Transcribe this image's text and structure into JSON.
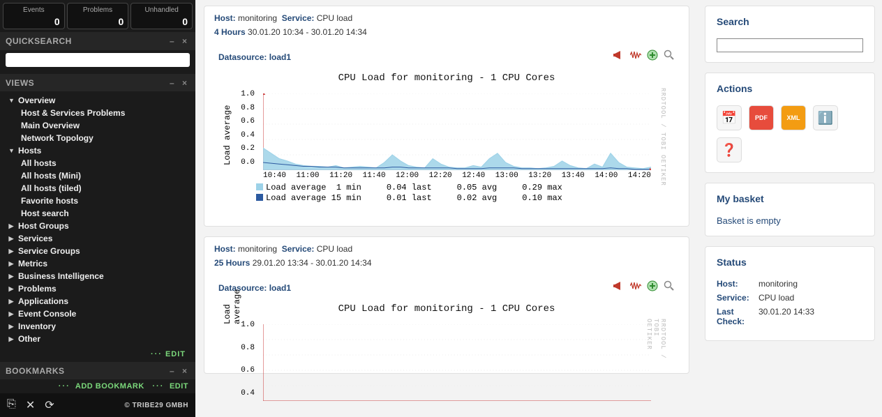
{
  "topstats": [
    {
      "label": "Events",
      "value": "0"
    },
    {
      "label": "Problems",
      "value": "0"
    },
    {
      "label": "Unhandled",
      "value": "0"
    }
  ],
  "quicksearch": {
    "title": "QUICKSEARCH",
    "value": ""
  },
  "views": {
    "title": "VIEWS",
    "edit": "EDIT",
    "tree": [
      {
        "label": "Overview",
        "bold": true,
        "expanded": true,
        "children": [
          {
            "label": "Host & Services Problems"
          },
          {
            "label": "Main Overview"
          },
          {
            "label": "Network Topology"
          }
        ]
      },
      {
        "label": "Hosts",
        "bold": true,
        "expanded": true,
        "children": [
          {
            "label": "All hosts"
          },
          {
            "label": "All hosts (Mini)"
          },
          {
            "label": "All hosts (tiled)"
          },
          {
            "label": "Favorite hosts"
          },
          {
            "label": "Host search"
          }
        ]
      },
      {
        "label": "Host Groups",
        "bold": true
      },
      {
        "label": "Services",
        "bold": true
      },
      {
        "label": "Service Groups",
        "bold": true
      },
      {
        "label": "Metrics",
        "bold": true
      },
      {
        "label": "Business Intelligence",
        "bold": true
      },
      {
        "label": "Problems",
        "bold": true
      },
      {
        "label": "Applications",
        "bold": true
      },
      {
        "label": "Event Console",
        "bold": true
      },
      {
        "label": "Inventory",
        "bold": true
      },
      {
        "label": "Other",
        "bold": true
      }
    ]
  },
  "bookmarks": {
    "title": "BOOKMARKS",
    "add": "ADD BOOKMARK",
    "edit": "EDIT"
  },
  "footer": {
    "copyright": "© TRIBE29 GMBH"
  },
  "panels": [
    {
      "host_label": "Host:",
      "host": "monitoring",
      "service_label": "Service:",
      "service": "CPU load",
      "range_label": "4 Hours",
      "range": "30.01.20 10:34 - 30.01.20 14:34",
      "datasource_label": "Datasource:",
      "datasource": "load1",
      "chart_title": "CPU Load for monitoring - 1 CPU Cores",
      "axis_label": "Load average",
      "watermark": "RRDTOOL / TOBI OETIKER",
      "legend_lines": [
        "Load average  1 min     0.04 last     0.05 avg     0.29 max",
        "Load average 15 min     0.01 last     0.02 avg     0.10 max"
      ],
      "legend_colors": [
        "#9dd2e8",
        "#2c5aa0"
      ]
    },
    {
      "host_label": "Host:",
      "host": "monitoring",
      "service_label": "Service:",
      "service": "CPU load",
      "range_label": "25 Hours",
      "range": "29.01.20 13:34 - 30.01.20 14:34",
      "datasource_label": "Datasource:",
      "datasource": "load1",
      "chart_title": "CPU Load for monitoring - 1 CPU Cores",
      "axis_label": "Load average",
      "watermark": "RRDTOOL / TOBI OETIKER"
    }
  ],
  "chart_data": [
    {
      "type": "area",
      "title": "CPU Load for monitoring - 1 CPU Cores",
      "xlabel": "",
      "ylabel": "Load average",
      "ylim": [
        0,
        1.0
      ],
      "x_ticks": [
        "10:40",
        "11:00",
        "11:20",
        "11:40",
        "12:00",
        "12:20",
        "12:40",
        "13:00",
        "13:20",
        "13:40",
        "14:00",
        "14:20"
      ],
      "y_ticks": [
        0.0,
        0.2,
        0.4,
        0.6,
        0.8,
        1.0
      ],
      "series": [
        {
          "name": "Load average 1 min",
          "color": "#9dd2e8",
          "stats": {
            "last": 0.04,
            "avg": 0.05,
            "max": 0.29
          },
          "values": [
            0.29,
            0.22,
            0.15,
            0.12,
            0.08,
            0.06,
            0.05,
            0.05,
            0.04,
            0.06,
            0.03,
            0.04,
            0.05,
            0.04,
            0.03,
            0.1,
            0.2,
            0.12,
            0.06,
            0.04,
            0.03,
            0.15,
            0.08,
            0.04,
            0.03,
            0.03,
            0.06,
            0.04,
            0.15,
            0.22,
            0.1,
            0.05,
            0.03,
            0.03,
            0.02,
            0.03,
            0.05,
            0.12,
            0.06,
            0.03,
            0.02,
            0.08,
            0.04,
            0.22,
            0.1,
            0.04,
            0.03,
            0.02,
            0.04
          ]
        },
        {
          "name": "Load average 15 min",
          "color": "#2c5aa0",
          "stats": {
            "last": 0.01,
            "avg": 0.02,
            "max": 0.1
          },
          "values": [
            0.1,
            0.09,
            0.08,
            0.07,
            0.06,
            0.05,
            0.05,
            0.04,
            0.04,
            0.04,
            0.03,
            0.03,
            0.03,
            0.03,
            0.03,
            0.03,
            0.04,
            0.04,
            0.03,
            0.03,
            0.03,
            0.03,
            0.03,
            0.03,
            0.02,
            0.02,
            0.02,
            0.02,
            0.03,
            0.03,
            0.03,
            0.03,
            0.02,
            0.02,
            0.02,
            0.02,
            0.02,
            0.02,
            0.02,
            0.02,
            0.02,
            0.02,
            0.02,
            0.03,
            0.02,
            0.02,
            0.01,
            0.01,
            0.01
          ]
        }
      ]
    },
    {
      "type": "area",
      "title": "CPU Load for monitoring - 1 CPU Cores",
      "xlabel": "",
      "ylabel": "Load average",
      "ylim": [
        0,
        1.0
      ],
      "y_ticks": [
        0.4,
        0.6,
        0.8,
        1.0
      ]
    }
  ],
  "right": {
    "search": {
      "title": "Search",
      "value": ""
    },
    "actions": {
      "title": "Actions",
      "items": [
        {
          "name": "calendar-icon",
          "glyph": "📅"
        },
        {
          "name": "pdf-icon",
          "glyph": "PDF",
          "small": true,
          "bg": "#e74c3c",
          "fg": "#fff"
        },
        {
          "name": "xml-icon",
          "glyph": "XML",
          "small": true,
          "bg": "#f39c12",
          "fg": "#fff"
        },
        {
          "name": "info-icon",
          "glyph": "ℹ️"
        },
        {
          "name": "help-icon",
          "glyph": "❓"
        }
      ]
    },
    "basket": {
      "title": "My basket",
      "text": "Basket is empty"
    },
    "status": {
      "title": "Status",
      "rows": [
        {
          "k": "Host:",
          "v": "monitoring"
        },
        {
          "k": "Service:",
          "v": "CPU load"
        },
        {
          "k": "Last Check:",
          "v": "30.01.20 14:33"
        }
      ]
    }
  }
}
